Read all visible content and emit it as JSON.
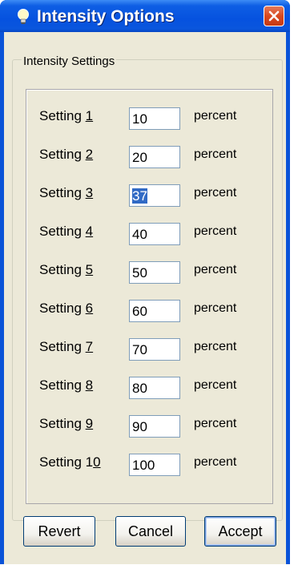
{
  "window": {
    "title": "Intensity Options"
  },
  "icons": {
    "app": "lightbulb-icon",
    "close": "close-icon"
  },
  "group": {
    "label": "Intensity Settings"
  },
  "settings": [
    {
      "prefix": "Setting ",
      "mnemonic": "1",
      "suffix": "",
      "value": "10",
      "unit": "percent"
    },
    {
      "prefix": "Setting ",
      "mnemonic": "2",
      "suffix": "",
      "value": "20",
      "unit": "percent"
    },
    {
      "prefix": "Setting ",
      "mnemonic": "3",
      "suffix": "",
      "value": "37",
      "unit": "percent"
    },
    {
      "prefix": "Setting ",
      "mnemonic": "4",
      "suffix": "",
      "value": "40",
      "unit": "percent"
    },
    {
      "prefix": "Setting ",
      "mnemonic": "5",
      "suffix": "",
      "value": "50",
      "unit": "percent"
    },
    {
      "prefix": "Setting ",
      "mnemonic": "6",
      "suffix": "",
      "value": "60",
      "unit": "percent"
    },
    {
      "prefix": "Setting ",
      "mnemonic": "7",
      "suffix": "",
      "value": "70",
      "unit": "percent"
    },
    {
      "prefix": "Setting ",
      "mnemonic": "8",
      "suffix": "",
      "value": "80",
      "unit": "percent"
    },
    {
      "prefix": "Setting ",
      "mnemonic": "9",
      "suffix": "",
      "value": "90",
      "unit": "percent"
    },
    {
      "prefix": "Setting 1",
      "mnemonic": "0",
      "suffix": "",
      "value": "100",
      "unit": "percent"
    }
  ],
  "buttons": {
    "revert": "Revert",
    "cancel": "Cancel",
    "accept": "Accept"
  },
  "colors": {
    "titlebar": "#0a53d8",
    "selection": "#316ac5",
    "face": "#ece9d8"
  }
}
